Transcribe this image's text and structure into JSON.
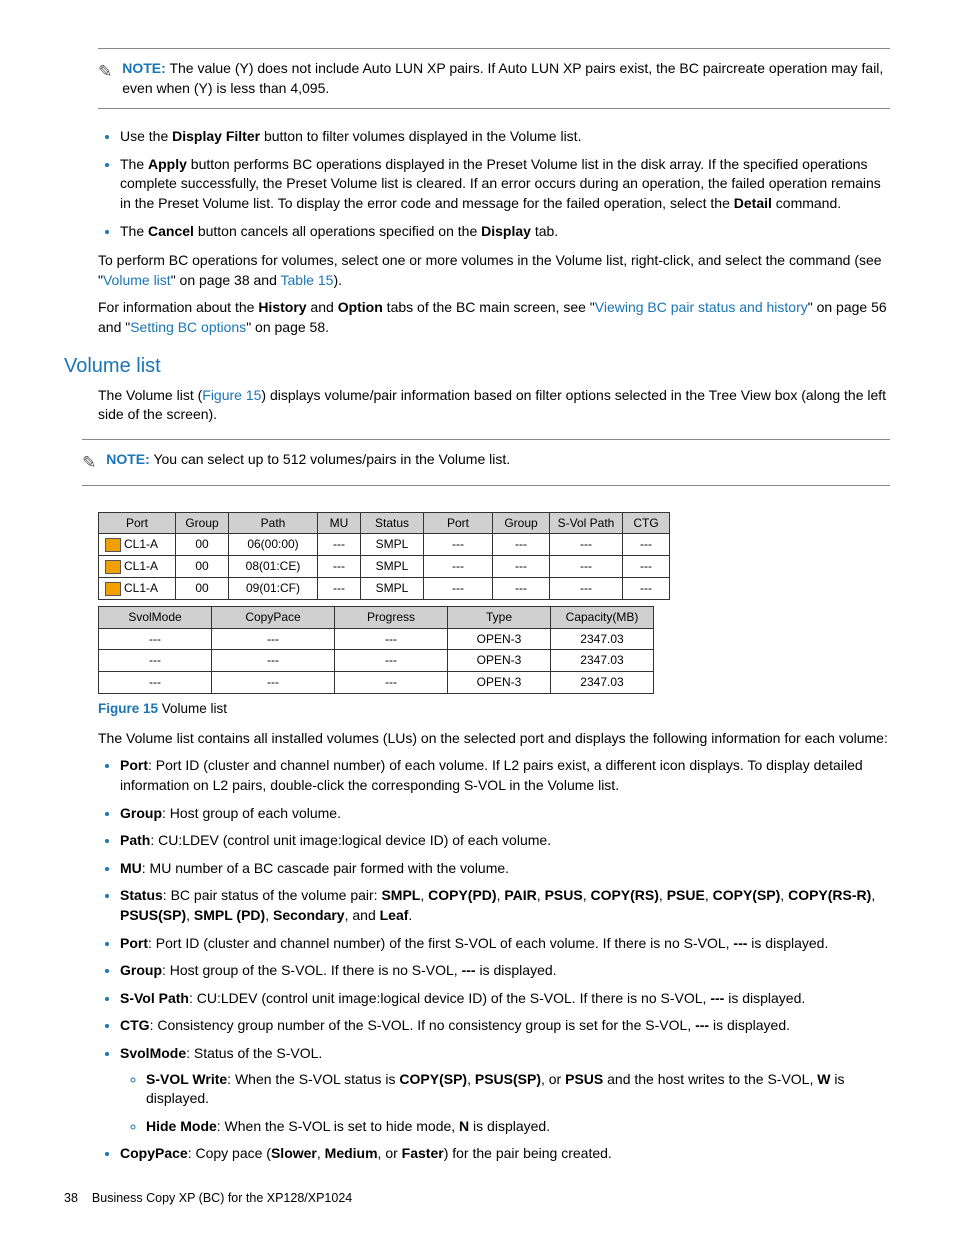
{
  "note1": {
    "label": "NOTE:",
    "text": "The value (Y) does not include Auto LUN XP pairs. If Auto LUN XP pairs exist, the BC paircreate operation may fail, even when (Y) is less than 4,095."
  },
  "bullets_top": {
    "b1_pre": "Use the ",
    "b1_bold": "Display Filter",
    "b1_post": " button to filter volumes displayed in the Volume list.",
    "b2_pre": "The ",
    "b2_bold1": "Apply",
    "b2_mid": " button performs BC operations displayed in the Preset Volume list in the disk array. If the specified operations complete successfully, the Preset Volume list is cleared. If an error occurs during an operation, the failed operation remains in the Preset Volume list. To display the error code and message for the failed operation, select the ",
    "b2_bold2": "Detail",
    "b2_post": " command.",
    "b3_pre": "The ",
    "b3_bold1": "Cancel",
    "b3_mid": " button cancels all operations specified on the ",
    "b3_bold2": "Display",
    "b3_post": " tab."
  },
  "para_perform": {
    "pre": "To perform BC operations for volumes, select one or more volumes in the Volume list, right-click, and select the command (see \"",
    "link1": "Volume list",
    "mid1": "\" on page 38 and ",
    "link2": "Table 15",
    "post": ")."
  },
  "para_info": {
    "pre": "For information about the ",
    "b1": "History",
    "mid1": " and ",
    "b2": "Option",
    "mid2": " tabs of the BC main screen, see \"",
    "link1": "Viewing BC pair status and history",
    "mid3": "\" on page 56 and \"",
    "link2": "Setting BC options",
    "post": "\" on page 58."
  },
  "section_title": "Volume list",
  "para_vol_intro": {
    "pre": "The Volume list (",
    "link": "Figure 15",
    "post": ") displays volume/pair information based on filter options selected in the Tree View box (along the left side of the screen)."
  },
  "note2": {
    "label": "NOTE:",
    "text": "You can select up to 512 volumes/pairs in the Volume list."
  },
  "table1": {
    "headers": [
      "Port",
      "Group",
      "Path",
      "MU",
      "Status",
      "Port",
      "Group",
      "S-Vol Path",
      "CTG"
    ],
    "rows": [
      [
        "CL1-A",
        "00",
        "06(00:00)",
        "---",
        "SMPL",
        "---",
        "---",
        "---",
        "---"
      ],
      [
        "CL1-A",
        "00",
        "08(01:CE)",
        "---",
        "SMPL",
        "---",
        "---",
        "---",
        "---"
      ],
      [
        "CL1-A",
        "00",
        "09(01:CF)",
        "---",
        "SMPL",
        "---",
        "---",
        "---",
        "---"
      ]
    ]
  },
  "table2": {
    "headers": [
      "SvolMode",
      "CopyPace",
      "Progress",
      "Type",
      "Capacity(MB)"
    ],
    "rows": [
      [
        "---",
        "---",
        "---",
        "OPEN-3",
        "2347.03"
      ],
      [
        "---",
        "---",
        "---",
        "OPEN-3",
        "2347.03"
      ],
      [
        "---",
        "---",
        "---",
        "OPEN-3",
        "2347.03"
      ]
    ]
  },
  "figure": {
    "label": "Figure 15",
    "caption": " Volume list"
  },
  "para_after_fig": "The Volume list contains all installed volumes (LUs) on the selected port and displays the following information for each volume:",
  "defs": {
    "port1_b": "Port",
    "port1_t": ": Port ID (cluster and channel number) of each volume. If L2 pairs exist, a different icon displays. To display detailed information on L2 pairs, double-click the corresponding S-VOL in the Volume list.",
    "group1_b": "Group",
    "group1_t": ": Host group of each volume.",
    "path_b": "Path",
    "path_t": ": CU:LDEV (control unit image:logical device ID) of each volume.",
    "mu_b": "MU",
    "mu_t": ": MU number of a BC cascade pair formed with the volume.",
    "status_b": "Status",
    "status_mid": ": BC pair status of the volume pair: ",
    "status_list": "SMPL, COPY(PD), PAIR, PSUS, COPY(RS), PSUE, COPY(SP), COPY(RS-R), PSUS(SP), SMPL (PD), Secondary",
    "status_and": ", and ",
    "status_last": "Leaf",
    "status_dot": ".",
    "port2_b": "Port",
    "port2_pre": ": Port ID (cluster and channel number) of the first S-VOL of each volume. If there is no S-VOL, ",
    "port2_dash": "---",
    "port2_post": " is displayed.",
    "group2_b": "Group",
    "group2_pre": ": Host group of the S-VOL. If there is no S-VOL, ",
    "group2_dash": "---",
    "group2_post": " is displayed.",
    "svolpath_b": "S-Vol Path",
    "svolpath_pre": ": CU:LDEV (control unit image:logical device ID) of the S-VOL. If there is no S-VOL, ",
    "svolpath_dash": "---",
    "svolpath_post": " is displayed.",
    "ctg_b": "CTG",
    "ctg_pre": ": Consistency group number of the S-VOL. If no consistency group is set for the S-VOL, ",
    "ctg_dash": "---",
    "ctg_post": " is displayed.",
    "svolmode_b": "SvolMode",
    "svolmode_t": ": Status of the S-VOL.",
    "svol_sub1_b": "S-VOL Write",
    "svol_sub1_pre": ": When the S-VOL status is ",
    "svol_sub1_b1": "COPY(SP)",
    "svol_sub1_c1": ", ",
    "svol_sub1_b2": "PSUS(SP)",
    "svol_sub1_c2": ", or ",
    "svol_sub1_b3": "PSUS",
    "svol_sub1_mid": " and the host writes to the S-VOL, ",
    "svol_sub1_b4": "W",
    "svol_sub1_post": " is displayed.",
    "svol_sub2_b": "Hide Mode",
    "svol_sub2_pre": ": When the S-VOL is set to hide mode, ",
    "svol_sub2_b1": "N",
    "svol_sub2_post": " is displayed.",
    "copypace_b": "CopyPace",
    "copypace_pre": ": Copy pace (",
    "copypace_b1": "Slower",
    "copypace_c1": ", ",
    "copypace_b2": "Medium",
    "copypace_c2": ", or ",
    "copypace_b3": "Faster",
    "copypace_post": ") for the pair being created."
  },
  "footer": {
    "page": "38",
    "title": "Business Copy XP (BC) for the XP128/XP1024"
  }
}
